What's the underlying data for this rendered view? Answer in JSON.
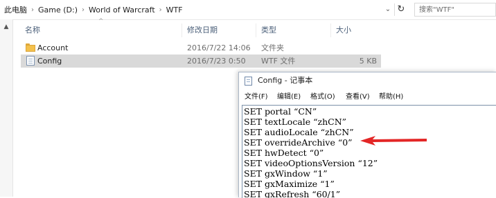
{
  "breadcrumb": [
    "此电脑",
    "Game (D:)",
    "World of Warcraft",
    "WTF"
  ],
  "search": {
    "placeholder": "搜索\"WTF\""
  },
  "columns": {
    "name": "名称",
    "modified": "修改日期",
    "type": "类型",
    "size": "大小"
  },
  "files": [
    {
      "name": "Account",
      "modified": "2016/7/22 14:06",
      "type": "文件夹",
      "size": "",
      "icon": "folder-icon"
    },
    {
      "name": "Config",
      "modified": "2016/7/23 0:50",
      "type": "WTF 文件",
      "size": "5 KB",
      "icon": "file-icon",
      "selected": true
    }
  ],
  "notepad": {
    "title": "Config - 记事本",
    "menu": [
      "文件(F)",
      "编辑(E)",
      "格式(O)",
      "查看(V)",
      "帮助(H)"
    ],
    "lines": [
      "SET portal “CN”",
      "SET textLocale “zhCN”",
      "SET audioLocale “zhCN”",
      "SET overrideArchive “0”",
      "SET hwDetect “0”",
      "SET videoOptionsVersion “12”",
      "SET gxWindow “1”",
      "SET gxMaximize “1”",
      "SET gxRefresh “60/1”"
    ]
  },
  "annotation": {
    "color": "#e32626"
  },
  "colors": {
    "selection": "#d9d9d9",
    "header_text": "#4c607a",
    "folder": "#f4c14c"
  }
}
